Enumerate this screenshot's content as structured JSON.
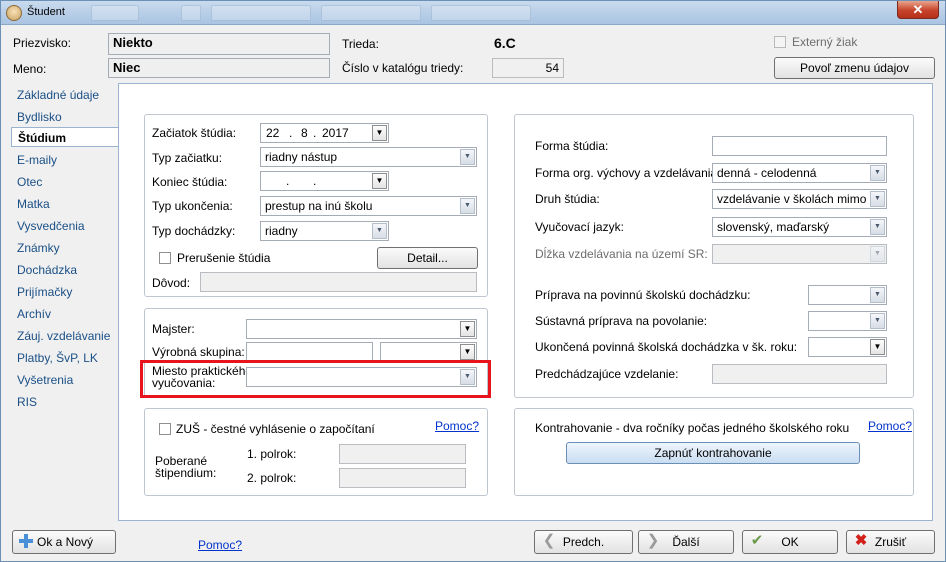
{
  "window": {
    "title": "Študent",
    "close_glyph": "✕"
  },
  "header": {
    "surname_label": "Priezvisko:",
    "surname_value": "Niekto",
    "name_label": "Meno:",
    "name_value": "Niec",
    "class_label": "Trieda:",
    "class_value": "6.C",
    "catalog_label": "Číslo v katalógu triedy:",
    "catalog_value": "54",
    "external_label": "Externý žiak",
    "allow_change_button": "Povoľ zmenu údajov"
  },
  "sidebar": {
    "items": [
      {
        "label": "Základné údaje"
      },
      {
        "label": "Bydlisko"
      },
      {
        "label": "Štúdium"
      },
      {
        "label": "E-maily"
      },
      {
        "label": "Otec"
      },
      {
        "label": "Matka"
      },
      {
        "label": "Vysvedčenia"
      },
      {
        "label": "Známky"
      },
      {
        "label": "Dochádzka"
      },
      {
        "label": "Prijímačky"
      },
      {
        "label": "Archív"
      },
      {
        "label": "Záuj. vzdelávanie"
      },
      {
        "label": "Platby, ŠvP, LK"
      },
      {
        "label": "Vyšetrenia"
      },
      {
        "label": "RIS"
      }
    ],
    "active_index": 2
  },
  "study": {
    "start_label": "Začiatok štúdia:",
    "start_day": "22",
    "start_month": "8",
    "start_year": "2017",
    "start_type_label": "Typ začiatku:",
    "start_type_value": "riadny nástup",
    "end_label": "Koniec štúdia:",
    "end_type_label": "Typ ukončenia:",
    "end_type_value": "prestup na inú školu",
    "attendance_label": "Typ dochádzky:",
    "attendance_value": "riadny",
    "interruption_label": "Prerušenie štúdia",
    "detail_button": "Detail...",
    "reason_label": "Dôvod:"
  },
  "practice": {
    "master_label": "Majster:",
    "group_label": "Výrobná skupina:",
    "place_label_1": "Miesto praktického",
    "place_label_2": "vyučovania:"
  },
  "zus": {
    "checkbox_label": "ZUŠ - čestné vyhlásenie o započítaní",
    "help_link": "Pomoc?",
    "stipend_label_1": "Poberané",
    "stipend_label_2": "štipendium:",
    "semester1_label": "1. polrok:",
    "semester2_label": "2. polrok:"
  },
  "form": {
    "form_label": "Forma štúdia:",
    "org_form_label": "Forma org. výchovy a vzdelávania:",
    "org_form_value": "denná - celodenná",
    "study_type_label": "Druh štúdia:",
    "study_type_value": "vzdelávanie v školách mimo úz",
    "language_label": "Vyučovací jazyk:",
    "language_value": "slovenský, maďarský",
    "length_label": "Dĺžka vzdelávania na území SR:",
    "prep_label": "Príprava na povinnú školskú dochádzku:",
    "continuous_label": "Sústavná príprava na povolanie:",
    "completed_label": "Ukončená povinná školská dochádzka v šk. roku:",
    "previous_label": "Predchádzajúce vzdelanie:"
  },
  "contract": {
    "label": "Kontrahovanie - dva ročníky počas jedného školského roku",
    "help_link": "Pomoc?",
    "button": "Zapnúť kontrahovanie"
  },
  "footer": {
    "ok_new_button": "Ok a Nový",
    "help_link": "Pomoc?",
    "prev_button": "Predch.",
    "next_button": "Ďalší",
    "ok_button": "OK",
    "cancel_button": "Zrušiť"
  },
  "colors": {
    "highlight": "#e8141c",
    "link": "#0033cc",
    "sidebar_text": "#1a4f86"
  }
}
